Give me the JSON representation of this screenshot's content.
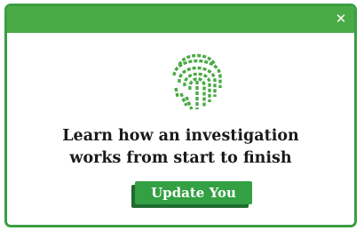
{
  "popup": {
    "close_symbol": "✕",
    "icon": "fingerprint-icon",
    "headline_line1": "Learn how an investigation",
    "headline_line2": "works from start to finish",
    "cta_label": "Update You"
  },
  "colors": {
    "accent_green": "#4aaa45",
    "border_green": "#3b9e44",
    "button_green": "#33a043",
    "button_shadow": "#1f6b2e",
    "text_dark": "#1a1a1a"
  }
}
